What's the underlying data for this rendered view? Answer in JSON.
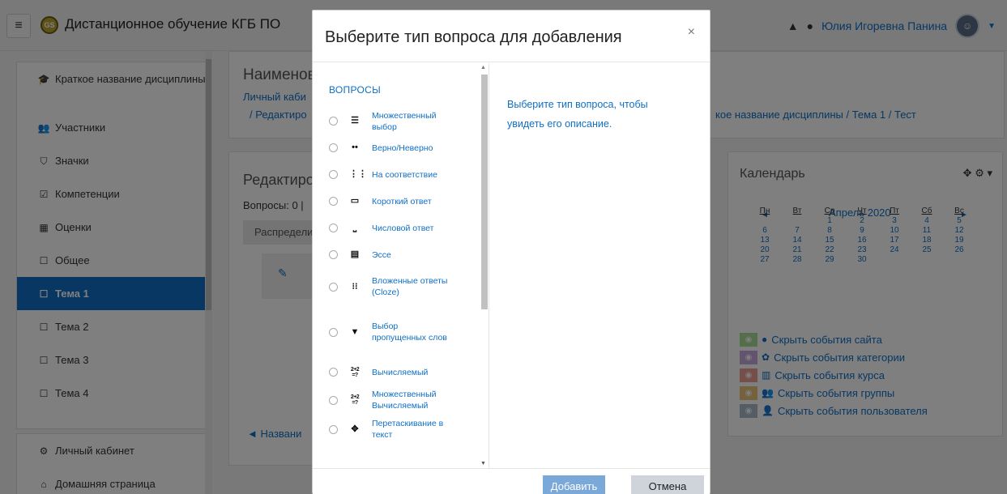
{
  "navbar": {
    "menu_icon": "≡",
    "logo_text": "GS",
    "site_name": "Дистанционное обучение КГБ ПО",
    "user_name": "Юлия Игоревна Панина",
    "icons": [
      "bell-icon",
      "chat-icon"
    ]
  },
  "drawer": {
    "items": [
      {
        "label": "Краткое название дисциплины",
        "icon": "graduation-cap-icon",
        "glyph": "🎓"
      },
      {
        "label": "Участники",
        "icon": "users-icon",
        "glyph": "👥"
      },
      {
        "label": "Значки",
        "icon": "shield-icon",
        "glyph": "⛉"
      },
      {
        "label": "Компетенции",
        "icon": "checkbox-icon",
        "glyph": "☑"
      },
      {
        "label": "Оценки",
        "icon": "table-icon",
        "glyph": "▦"
      },
      {
        "label": "Общее",
        "icon": "folder-icon",
        "glyph": "☐"
      },
      {
        "label": "Тема 1",
        "icon": "folder-icon",
        "glyph": "☐"
      },
      {
        "label": "Тема 2",
        "icon": "folder-icon",
        "glyph": "☐"
      },
      {
        "label": "Тема 3",
        "icon": "folder-icon",
        "glyph": "☐"
      },
      {
        "label": "Тема 4",
        "icon": "folder-icon",
        "glyph": "☐"
      }
    ],
    "items2": [
      {
        "label": "Личный кабинет",
        "icon": "dashboard-icon",
        "glyph": "⚙"
      },
      {
        "label": "Домашняя страница",
        "icon": "home-icon",
        "glyph": "⌂"
      }
    ]
  },
  "page": {
    "header_title": "Наименова",
    "breadcrumb_left": "Личный каби",
    "breadcrumb_left2": "/ Редактиро",
    "breadcrumb_right": "кое название дисциплины / Тема 1 / Тест",
    "edit_title": "Редактиро",
    "questions_info": "Вопросы: 0 |",
    "distribute": "Распредели",
    "back_link": "◄ Названи"
  },
  "calendar": {
    "title": "Календарь",
    "month": "Апрель 2020",
    "prev": "◄",
    "next": "►",
    "weekdays": [
      "Пн",
      "Вт",
      "Ср",
      "Чт",
      "Пт",
      "Сб",
      "Вс"
    ],
    "weeks": [
      [
        "",
        "",
        "1",
        "2",
        "3",
        "4",
        "5"
      ],
      [
        "6",
        "7",
        "8",
        "9",
        "10",
        "11",
        "12"
      ],
      [
        "13",
        "14",
        "15",
        "16",
        "17",
        "18",
        "19"
      ],
      [
        "20",
        "21",
        "22",
        "23",
        "24",
        "25",
        "26"
      ],
      [
        "27",
        "28",
        "29",
        "30",
        "",
        "",
        ""
      ]
    ],
    "legend": [
      {
        "label": "Скрыть события сайта",
        "color": "#a9dd98",
        "icon": "globe-icon",
        "glyph": "●"
      },
      {
        "label": "Скрыть события категории",
        "color": "#c5a9dd",
        "icon": "cubes-icon",
        "glyph": "✿"
      },
      {
        "label": "Скрыть события курса",
        "color": "#ee9e94",
        "icon": "university-icon",
        "glyph": "▥"
      },
      {
        "label": "Скрыть события группы",
        "color": "#ecc37a",
        "icon": "group-icon",
        "glyph": "👥"
      },
      {
        "label": "Скрыть события пользователя",
        "color": "#a9b9c9",
        "icon": "user-icon",
        "glyph": "👤"
      }
    ]
  },
  "modal": {
    "title": "Выберите тип вопроса для добавления",
    "close": "×",
    "section_header": "ВОПРОСЫ",
    "description": "Выберите тип вопроса, чтобы увидеть его описание.",
    "add_label": "Добавить",
    "cancel_label": "Отмена",
    "question_types": [
      {
        "label": "Множественный выбор",
        "icon": "multichoice-icon",
        "glyph": "☰"
      },
      {
        "label": "Верно/Неверно",
        "icon": "truefalse-icon",
        "glyph": "••"
      },
      {
        "label": "На соответствие",
        "icon": "match-icon",
        "glyph": "⋮⋮"
      },
      {
        "label": "Короткий ответ",
        "icon": "shortanswer-icon",
        "glyph": "▭"
      },
      {
        "label": "Числовой ответ",
        "icon": "numerical-icon",
        "glyph": "⎵"
      },
      {
        "label": "Эссе",
        "icon": "essay-icon",
        "glyph": "▤"
      },
      {
        "label": "Вложенные ответы (Cloze)",
        "icon": "cloze-icon",
        "glyph": "⁝⁝"
      },
      {
        "label": "Выбор пропущенных слов",
        "icon": "dropdown-icon",
        "glyph": "▼"
      },
      {
        "label": "Вычисляемый",
        "icon": "calculated-icon",
        "glyph": "2+2 =?"
      },
      {
        "label": "Множественный Вычисляемый",
        "icon": "calcmulti-icon",
        "glyph": "2+2 =?"
      },
      {
        "label": "Перетаскивание в текст",
        "icon": "ddwtos-icon",
        "glyph": "✥"
      }
    ]
  }
}
